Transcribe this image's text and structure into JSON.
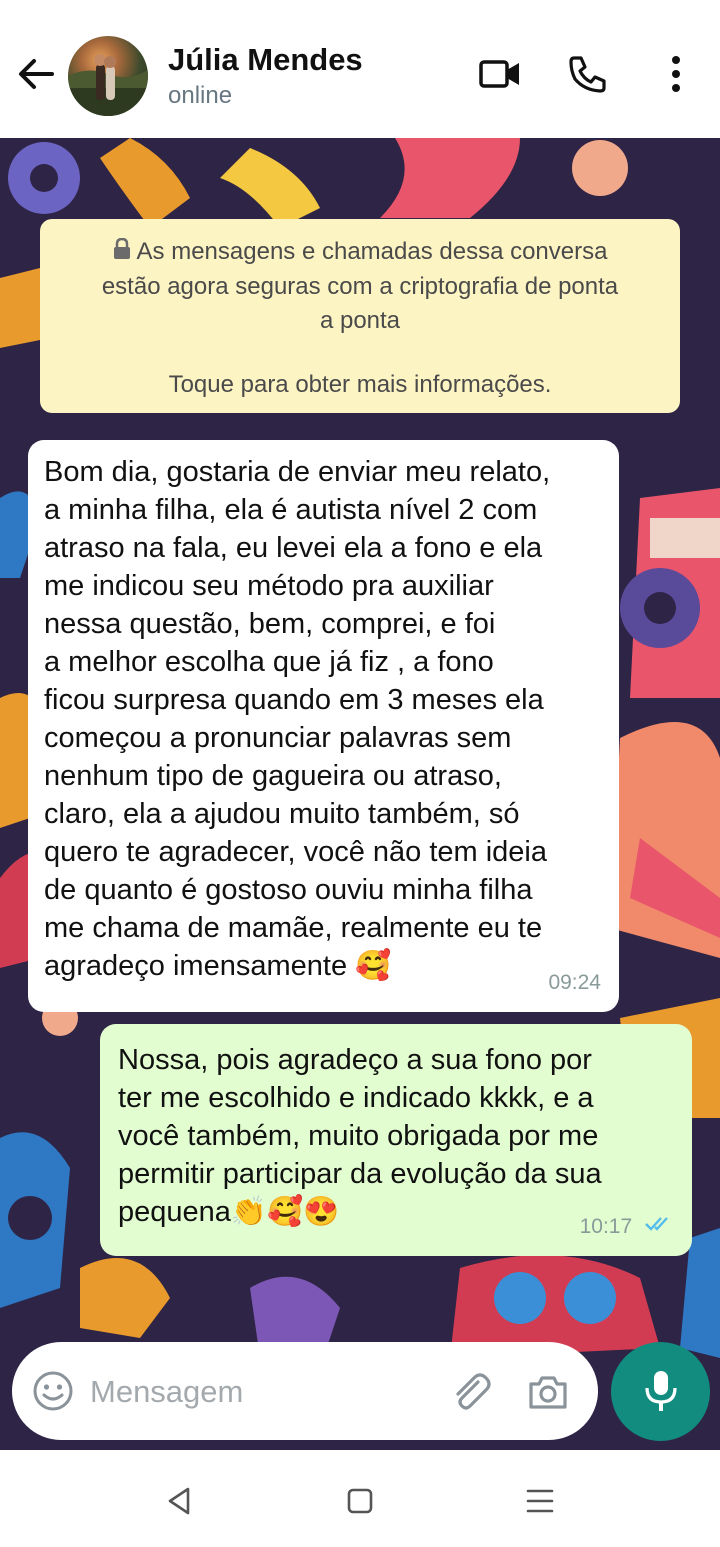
{
  "header": {
    "contact_name": "Júlia Mendes",
    "status": "online",
    "icons": [
      "back-arrow-icon",
      "video-call-icon",
      "voice-call-icon",
      "more-options-icon"
    ]
  },
  "notice": {
    "line1": "As mensagens e chamadas dessa conversa",
    "line2": "estão agora seguras com a criptografia de ponta",
    "line3": "a ponta",
    "line4": "Toque para obter mais informações.",
    "icon": "lock-icon"
  },
  "messages": [
    {
      "direction": "incoming",
      "text": "Bom dia, gostaria de enviar meu relato,\na minha filha, ela é autista nível 2 com\natraso na fala, eu levei ela a fono e ela\nme indicou seu método pra auxiliar\nnessa questão, bem, comprei, e foi\na melhor escolha que já fiz , a fono\nficou surpresa quando em 3 meses ela\ncomeçou a pronunciar palavras sem\nnenhum tipo de gagueira ou atraso,\nclaro, ela a ajudou muito também, só\nquero te agradecer, você não tem ideia\nde quanto é gostoso ouviu minha filha\nme chama de mamãe, realmente eu te\nagradeço imensamente 🥰",
      "time": "09:24"
    },
    {
      "direction": "outgoing",
      "text": "Nossa, pois agradeço a sua fono  por\nter me escolhido e indicado kkkk, e a\nvocê também, muito obrigada por me\npermitir participar da evolução da sua\npequena👏🥰😍",
      "time": "10:17",
      "read": true
    }
  ],
  "composer": {
    "placeholder": "Mensagem",
    "icons": [
      "emoji-icon",
      "attach-icon",
      "camera-icon",
      "mic-icon"
    ]
  },
  "colors": {
    "wallpaper": "#2e2446",
    "notice_bg": "#fdf4c4",
    "incoming_bg": "#ffffff",
    "outgoing_bg": "#e2fdd0",
    "accent": "#128c7e",
    "read_ticks": "#53bdeb"
  },
  "navbar": {
    "icons": [
      "nav-back-icon",
      "nav-home-icon",
      "nav-recents-icon"
    ]
  }
}
